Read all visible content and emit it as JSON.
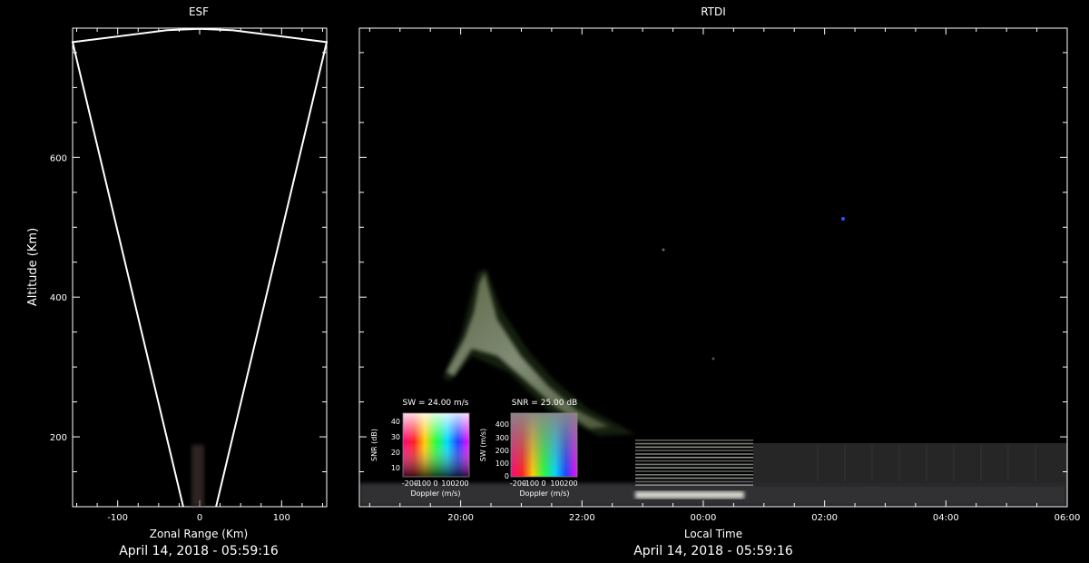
{
  "chart_data": [
    {
      "type": "scatter",
      "title": "ESF",
      "xlabel": "Zonal Range (Km)",
      "ylabel": "Altitude (Km)",
      "xlim": [
        -155,
        155
      ],
      "ylim": [
        100,
        785
      ],
      "xticks": [
        -100,
        0,
        100
      ],
      "yticks": [
        200,
        400,
        600
      ],
      "footer": "April 14, 2018 - 05:59:16",
      "outline": {
        "name": "beam-sector",
        "points": [
          [
            -20,
            100
          ],
          [
            -155,
            765
          ],
          [
            -40,
            782
          ],
          [
            0,
            784
          ],
          [
            40,
            782
          ],
          [
            155,
            765
          ],
          [
            20,
            100
          ]
        ]
      }
    },
    {
      "type": "heatmap",
      "title": "RTDI",
      "xlabel": "Local Time",
      "ylabel": "",
      "xticks": [
        "20:00",
        "22:00",
        "00:00",
        "02:00",
        "04:00",
        "06:00"
      ],
      "xtick_hours": [
        20,
        22,
        24,
        26,
        28,
        30
      ],
      "xlim_hours": [
        18.33,
        30.0
      ],
      "ylim": [
        100,
        785
      ],
      "footer": "April 14, 2018 - 05:59:16",
      "legends": [
        {
          "title": "SW = 24.00 m/s",
          "xlabel": "Doppler (m/s)",
          "ylabel": "SNR (dB)",
          "xticks": [
            "-200",
            "-100",
            "0",
            "100",
            "200"
          ],
          "yticks": [
            "10",
            "20",
            "30",
            "40"
          ]
        },
        {
          "title": "SNR = 25.00 dB",
          "xlabel": "Doppler (m/s)",
          "ylabel": "SW (m/s)",
          "xticks": [
            "-200",
            "-100",
            "0",
            "100",
            "200"
          ],
          "yticks": [
            "0",
            "100",
            "200",
            "300",
            "400"
          ]
        }
      ]
    }
  ]
}
